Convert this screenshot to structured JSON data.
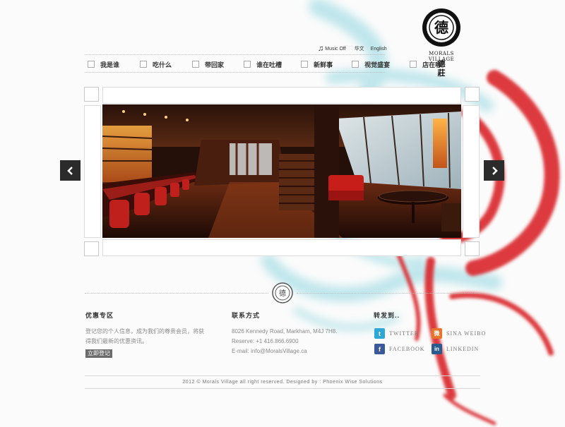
{
  "brand": {
    "name": "MORALS VILLAGE",
    "name_cn": "德莊",
    "seal_char": "德"
  },
  "utility": {
    "music": "Music Off",
    "lang_cn": "华文",
    "lang_en": "English"
  },
  "nav": {
    "items": [
      {
        "label": "我是谁"
      },
      {
        "label": "吃什么"
      },
      {
        "label": "带回家"
      },
      {
        "label": "谁在吐槽"
      },
      {
        "label": "新鲜事"
      },
      {
        "label": "视觉盛宴"
      },
      {
        "label": "店在哪"
      }
    ]
  },
  "slider": {
    "prev_icon": "chevron-left-icon",
    "next_icon": "chevron-right-icon"
  },
  "promo": {
    "title": "优惠专区",
    "text_line1": "登记您的个人信息，成为我们的尊贵会员，将获",
    "text_line2": "得我们最新的优惠资讯。",
    "button": "立即登记"
  },
  "contact": {
    "title": "联系方式",
    "address": "8026 Kennedy Road, Markham, M4J 7H8.",
    "reserve": "Reserve: +1 416.866.6900",
    "email": "E-mail: info@MoralsVillage.ca"
  },
  "share": {
    "title": "转发到..",
    "items": [
      {
        "label": "TWITTER",
        "icon": "twitter-icon",
        "glyph": "t",
        "color": "#2fa8d8"
      },
      {
        "label": "SINA WEIBO",
        "icon": "weibo-icon",
        "glyph": "微",
        "color": "#e8742c"
      },
      {
        "label": "FACEBOOK",
        "icon": "facebook-icon",
        "glyph": "f",
        "color": "#3b5998"
      },
      {
        "label": "LINKEDIN",
        "icon": "linkedin-icon",
        "glyph": "in",
        "color": "#2a5b8c"
      }
    ]
  },
  "footer": {
    "copyright": "2012 ©  Morals Village all right reserved.   Designed by : Phoenix Wise Solutions"
  },
  "colors": {
    "ink_red": "#d9252b",
    "ink_cyan": "#8fd6e0",
    "text_dark": "#333333"
  }
}
